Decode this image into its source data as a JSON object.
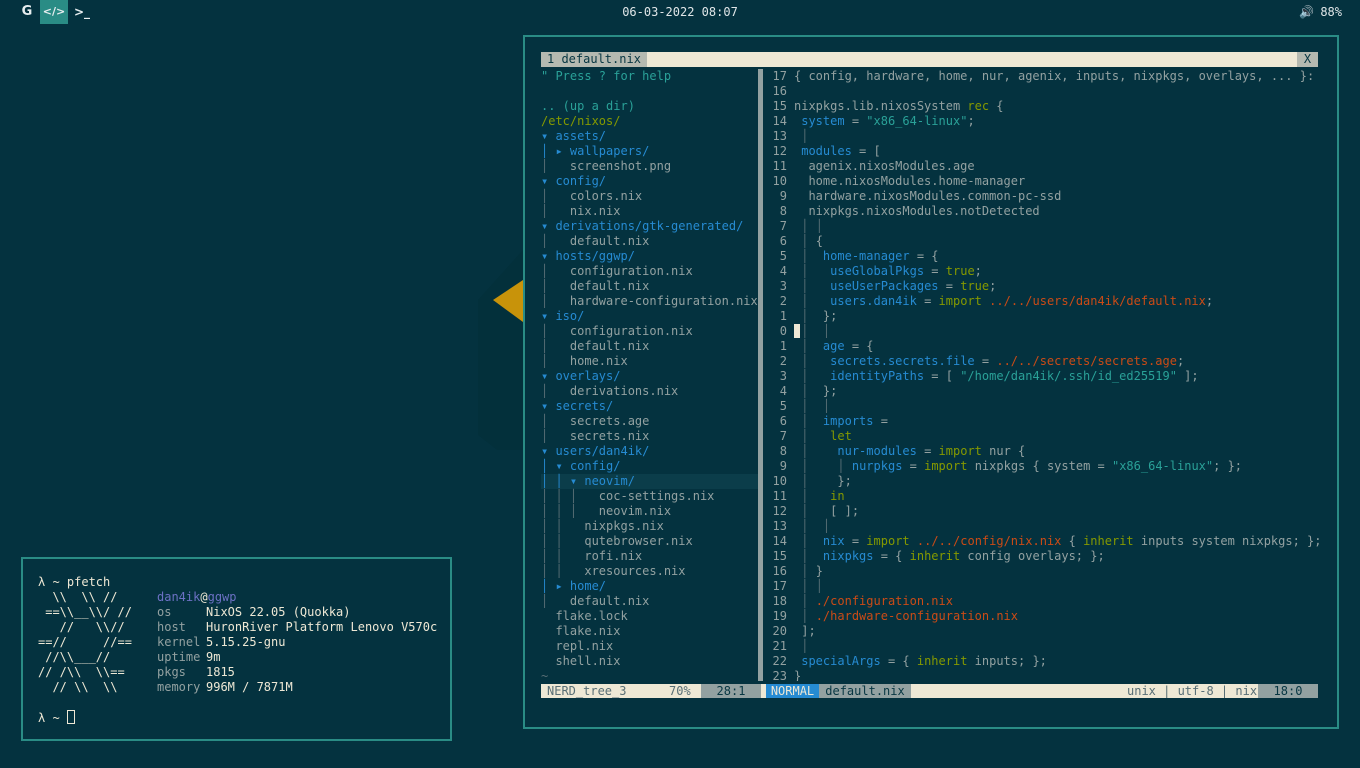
{
  "topbar": {
    "workspaces": [
      {
        "label": "G",
        "icon": "google-icon"
      },
      {
        "label": "</>",
        "icon": "code-icon"
      },
      {
        "label": ">_",
        "icon": "terminal-icon"
      }
    ],
    "clock": "06-03-2022 08:07",
    "volume_icon": "🔊",
    "battery": "88%"
  },
  "colors": {
    "background": "#04323f",
    "accent": "#2a8c85",
    "hexagon": "#c8930a"
  },
  "vim": {
    "tab_label": "1 default.nix",
    "close_label": "X",
    "tree_lines": [
      "\" Press ? for help",
      "",
      ".. (up a dir)",
      "/etc/nixos/",
      "▾ assets/",
      "│ ▸ wallpapers/",
      "│   screenshot.png",
      "▾ config/",
      "│   colors.nix",
      "│   nix.nix",
      "▾ derivations/gtk-generated/",
      "│   default.nix",
      "▾ hosts/ggwp/",
      "│   configuration.nix",
      "│   default.nix",
      "│   hardware-configuration.nix",
      "▾ iso/",
      "│   configuration.nix",
      "│   default.nix",
      "│   home.nix",
      "▾ overlays/",
      "│   derivations.nix",
      "▾ secrets/",
      "│   secrets.age",
      "│   secrets.nix",
      "▾ users/dan4ik/",
      "│ ▾ config/",
      "│ │ ▾ neovim/",
      "│ │ │   coc-settings.nix",
      "│ │ │   neovim.nix",
      "│ │   nixpkgs.nix",
      "│ │   qutebrowser.nix",
      "│ │   rofi.nix",
      "│ │   xresources.nix",
      "│ ▸ home/",
      "│   default.nix",
      "  flake.lock",
      "  flake.nix",
      "  repl.nix",
      "  shell.nix",
      "~"
    ],
    "gutter": [
      "17",
      "16",
      "15",
      "14",
      "13",
      "12",
      "11",
      "10",
      "9",
      "8",
      "7",
      "6",
      "5",
      "4",
      "3",
      "2",
      "1",
      "0",
      "1",
      "2",
      "3",
      "4",
      "5",
      "6",
      "7",
      "8",
      "9",
      "10",
      "11",
      "12",
      "13",
      "14",
      "15",
      "16",
      "17",
      "18",
      "19",
      "20",
      "21",
      "22",
      "23"
    ],
    "code_lines": [
      "{ config, hardware, home, nur, agenix, inputs, nixpkgs, overlays, ... }:",
      "",
      "nixpkgs.lib.nixosSystem rec {",
      " system = \"x86_64-linux\";",
      " │",
      " modules = [",
      "  agenix.nixosModules.age",
      "  home.nixosModules.home-manager",
      "  hardware.nixosModules.common-pc-ssd",
      "  nixpkgs.nixosModules.notDetected",
      " │ │",
      " │ {",
      " │  home-manager = {",
      " │   useGlobalPkgs = true;",
      " │   useUserPackages = true;",
      " │   users.dan4ik = import ../../users/dan4ik/default.nix;",
      " │  };",
      " │  │",
      " │  age = {",
      " │   secrets.secrets.file = ../../secrets/secrets.age;",
      " │   identityPaths = [ \"/home/dan4ik/.ssh/id_ed25519\" ];",
      " │  };",
      " │  │",
      " │  imports =",
      " │   let",
      " │    nur-modules = import nur {",
      " │    │ nurpkgs = import nixpkgs { system = \"x86_64-linux\"; };",
      " │    };",
      " │   in",
      " │   [ ];",
      " │  │",
      " │  nix = import ../../config/nix.nix { inherit inputs system nixpkgs; };",
      " │  nixpkgs = { inherit config overlays; };",
      " │ }",
      " │ │",
      " │ ./configuration.nix",
      " │ ./hardware-configuration.nix",
      " ];",
      " │",
      " specialArgs = { inherit inputs; };",
      "}"
    ],
    "status": {
      "tree_name": "NERD_tree_3",
      "tree_percent": "70%",
      "tree_pos": "28:1",
      "mode": "NORMAL",
      "file": "default.nix",
      "fileinfo": "unix | utf-8 | nix",
      "pos": "18:0"
    }
  },
  "pfetch": {
    "prompt": "λ ~ pfetch",
    "logo": [
      "  \\\\  \\\\ //",
      " ==\\\\__\\\\/ //",
      "   //   \\\\//",
      "==//     //==",
      " //\\\\___//",
      "// /\\\\  \\\\==",
      "  // \\\\  \\\\"
    ],
    "user": "dan4ik",
    "at": "@",
    "host": "ggwp",
    "info": [
      {
        "label": "os",
        "value": "NixOS 22.05 (Quokka)"
      },
      {
        "label": "host",
        "value": "HuronRiver Platform Lenovo V570c"
      },
      {
        "label": "kernel",
        "value": "5.15.25-gnu"
      },
      {
        "label": "uptime",
        "value": "9m"
      },
      {
        "label": "pkgs",
        "value": "1815"
      },
      {
        "label": "memory",
        "value": "996M / 7871M"
      }
    ],
    "prompt2": "λ ~"
  }
}
